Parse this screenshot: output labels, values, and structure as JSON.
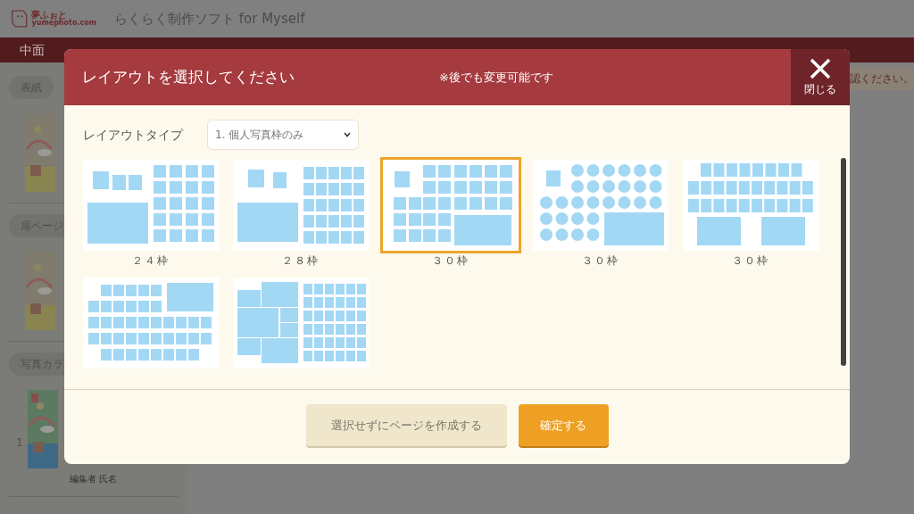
{
  "app": {
    "logo": {
      "name": "夢ふぉと",
      "url": "yumephoto.com"
    },
    "title": "らくらく制作ソフト for Myself",
    "nav": {
      "section": "中面"
    },
    "notice": "認ください。"
  },
  "sidebar": {
    "groups": [
      {
        "label": "表紙"
      },
      {
        "label": "扉ページ"
      },
      {
        "label": "写真カラ",
        "page_number": "1",
        "caption": "編集者 氏名"
      }
    ]
  },
  "dialog": {
    "title": "レイアウトを選択してください",
    "note": "※後でも変更可能です",
    "close_label": "閉じる",
    "layout_type": {
      "label": "レイアウトタイプ",
      "value": "1. 個人写真枠のみ"
    },
    "layouts": [
      {
        "kind": "big24",
        "label": "２４枠",
        "selected": false
      },
      {
        "kind": "big28",
        "label": "２８枠",
        "selected": false
      },
      {
        "kind": "big30",
        "label": "３０枠",
        "selected": true
      },
      {
        "kind": "circles",
        "label": "３０枠",
        "selected": false
      },
      {
        "kind": "rows",
        "label": "３０枠",
        "selected": false
      },
      {
        "kind": "wide",
        "selected": false
      },
      {
        "kind": "mosaic",
        "selected": false
      }
    ],
    "buttons": [
      {
        "kind": "secondary",
        "label": "選択せずにページを作成する"
      },
      {
        "kind": "primary",
        "label": "確定する"
      }
    ]
  }
}
